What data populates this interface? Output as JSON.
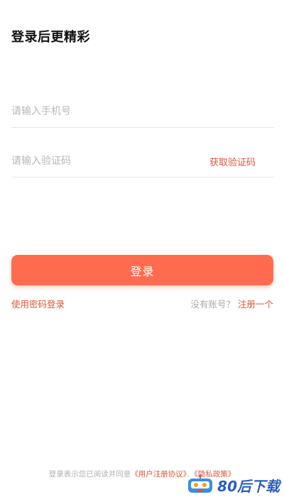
{
  "header": {
    "title": "登录后更精彩"
  },
  "form": {
    "phone_placeholder": "请输入手机号",
    "code_placeholder": "请输入验证码",
    "get_code_label": "获取验证码",
    "login_label": "登录",
    "password_login_label": "使用密码登录",
    "register_prompt": "没有账号？",
    "register_label": "注册一个"
  },
  "footer": {
    "agreement_prefix": "登录表示您已阅读并同意",
    "user_agreement": "《用户注册协议》",
    "separator": "、",
    "privacy_policy": "《隐私政策》"
  },
  "watermark": {
    "text": "80后下载",
    "icon": "robot-logo-icon"
  },
  "colors": {
    "accent": "#ff6b4e",
    "link": "#d9593a",
    "placeholder": "#b8b8b8",
    "divider": "#e6e6e6"
  }
}
